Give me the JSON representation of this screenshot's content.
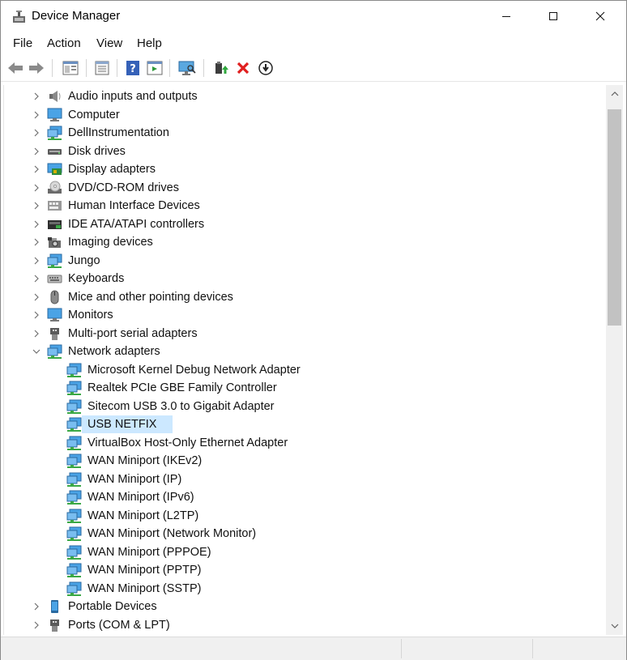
{
  "window": {
    "title": "Device Manager"
  },
  "menu": {
    "items": [
      "File",
      "Action",
      "View",
      "Help"
    ]
  },
  "toolbar": {
    "buttons": [
      "back-icon",
      "forward-icon",
      "show-hide-console-tree-icon",
      "properties-icon",
      "help-icon",
      "action-pane-icon",
      "monitor-icon",
      "update-driver-icon",
      "uninstall-icon",
      "disable-device-icon"
    ]
  },
  "tree": {
    "rows": [
      {
        "label": "Audio inputs and outputs",
        "icon": "speaker",
        "expanded": false,
        "level": 0
      },
      {
        "label": "Computer",
        "icon": "monitor",
        "expanded": false,
        "level": 0
      },
      {
        "label": "DellInstrumentation",
        "icon": "network",
        "expanded": false,
        "level": 0
      },
      {
        "label": "Disk drives",
        "icon": "disk",
        "expanded": false,
        "level": 0
      },
      {
        "label": "Display adapters",
        "icon": "display-adapter",
        "expanded": false,
        "level": 0
      },
      {
        "label": "DVD/CD-ROM drives",
        "icon": "dvd",
        "expanded": false,
        "level": 0
      },
      {
        "label": "Human Interface Devices",
        "icon": "hid",
        "expanded": false,
        "level": 0
      },
      {
        "label": "IDE ATA/ATAPI controllers",
        "icon": "ide",
        "expanded": false,
        "level": 0
      },
      {
        "label": "Imaging devices",
        "icon": "camera",
        "expanded": false,
        "level": 0
      },
      {
        "label": "Jungo",
        "icon": "network",
        "expanded": false,
        "level": 0
      },
      {
        "label": "Keyboards",
        "icon": "keyboard",
        "expanded": false,
        "level": 0
      },
      {
        "label": "Mice and other pointing devices",
        "icon": "mouse",
        "expanded": false,
        "level": 0
      },
      {
        "label": "Monitors",
        "icon": "monitor",
        "expanded": false,
        "level": 0
      },
      {
        "label": "Multi-port serial adapters",
        "icon": "serial",
        "expanded": false,
        "level": 0
      },
      {
        "label": "Network adapters",
        "icon": "network",
        "expanded": true,
        "level": 0
      },
      {
        "label": "Microsoft Kernel Debug Network Adapter",
        "icon": "network",
        "level": 1
      },
      {
        "label": "Realtek PCIe GBE Family Controller",
        "icon": "network",
        "level": 1
      },
      {
        "label": "Sitecom USB 3.0 to Gigabit Adapter",
        "icon": "network",
        "level": 1
      },
      {
        "label": "USB NETFIX",
        "icon": "network",
        "level": 1,
        "selected": true
      },
      {
        "label": "VirtualBox Host-Only Ethernet Adapter",
        "icon": "network",
        "level": 1
      },
      {
        "label": "WAN Miniport (IKEv2)",
        "icon": "network",
        "level": 1
      },
      {
        "label": "WAN Miniport (IP)",
        "icon": "network",
        "level": 1
      },
      {
        "label": "WAN Miniport (IPv6)",
        "icon": "network",
        "level": 1
      },
      {
        "label": "WAN Miniport (L2TP)",
        "icon": "network",
        "level": 1
      },
      {
        "label": "WAN Miniport (Network Monitor)",
        "icon": "network",
        "level": 1
      },
      {
        "label": "WAN Miniport (PPPOE)",
        "icon": "network",
        "level": 1
      },
      {
        "label": "WAN Miniport (PPTP)",
        "icon": "network",
        "level": 1
      },
      {
        "label": "WAN Miniport (SSTP)",
        "icon": "network",
        "level": 1
      },
      {
        "label": "Portable Devices",
        "icon": "portable",
        "expanded": false,
        "level": 0
      },
      {
        "label": "Ports (COM & LPT)",
        "icon": "serial",
        "expanded": false,
        "level": 0
      }
    ]
  },
  "colors": {
    "selection": "#cce8ff",
    "icon_blue": "#2c8fd6",
    "icon_green": "#3aa845",
    "delete_red": "#e01e1e"
  }
}
